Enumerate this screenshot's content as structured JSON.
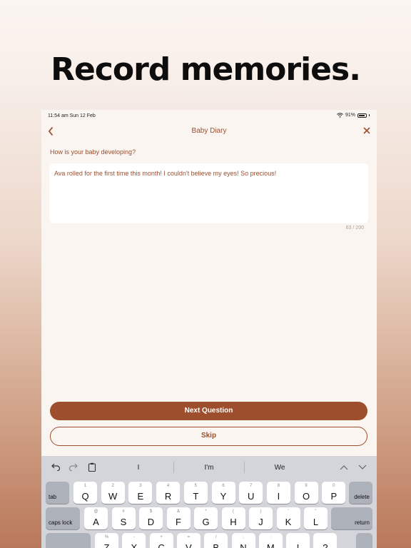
{
  "headline": "Record memories.",
  "status_bar": {
    "time": "11:54 am  Sun 12 Feb",
    "battery": "91%"
  },
  "nav": {
    "back_icon": "chevron-left-icon",
    "title": "Baby Diary",
    "close_icon": "close-icon"
  },
  "question": "How is your baby developing?",
  "answer": {
    "value": "Ava rolled for the first time this month! I couldn't believe my eyes! So precious!",
    "char_count": "83 / 200"
  },
  "buttons": {
    "next": "Next Question",
    "skip": "Skip"
  },
  "keyboard": {
    "suggestions": [
      "I",
      "I'm",
      "We"
    ],
    "row1": [
      {
        "hint": "1",
        "letter": "Q"
      },
      {
        "hint": "2",
        "letter": "W"
      },
      {
        "hint": "3",
        "letter": "E"
      },
      {
        "hint": "4",
        "letter": "R"
      },
      {
        "hint": "5",
        "letter": "T"
      },
      {
        "hint": "6",
        "letter": "Y"
      },
      {
        "hint": "7",
        "letter": "U"
      },
      {
        "hint": "8",
        "letter": "I"
      },
      {
        "hint": "9",
        "letter": "O"
      },
      {
        "hint": "0",
        "letter": "P"
      }
    ],
    "row2": [
      {
        "hint": "@",
        "letter": "A"
      },
      {
        "hint": "#",
        "letter": "S"
      },
      {
        "hint": "$",
        "letter": "D"
      },
      {
        "hint": "&",
        "letter": "F"
      },
      {
        "hint": "*",
        "letter": "G"
      },
      {
        "hint": "(",
        "letter": "H"
      },
      {
        "hint": ")",
        "letter": "J"
      },
      {
        "hint": "'",
        "letter": "K"
      },
      {
        "hint": "\"",
        "letter": "L"
      }
    ],
    "row3": [
      {
        "hint": "%",
        "letter": "Z"
      },
      {
        "hint": "-",
        "letter": "X"
      },
      {
        "hint": "+",
        "letter": "C"
      },
      {
        "hint": "=",
        "letter": "V"
      },
      {
        "hint": "/",
        "letter": "B"
      },
      {
        "hint": ";",
        "letter": "N"
      },
      {
        "hint": ":",
        "letter": "M"
      },
      {
        "hint": "",
        "letter": "!"
      },
      {
        "hint": "",
        "letter": "?"
      }
    ],
    "tab": "tab",
    "delete": "delete",
    "caps_lock": "caps lock",
    "return": "return"
  },
  "colors": {
    "accent": "#9c4e2d",
    "background": "#fbf5f1",
    "keyboard": "#d3d5db"
  }
}
